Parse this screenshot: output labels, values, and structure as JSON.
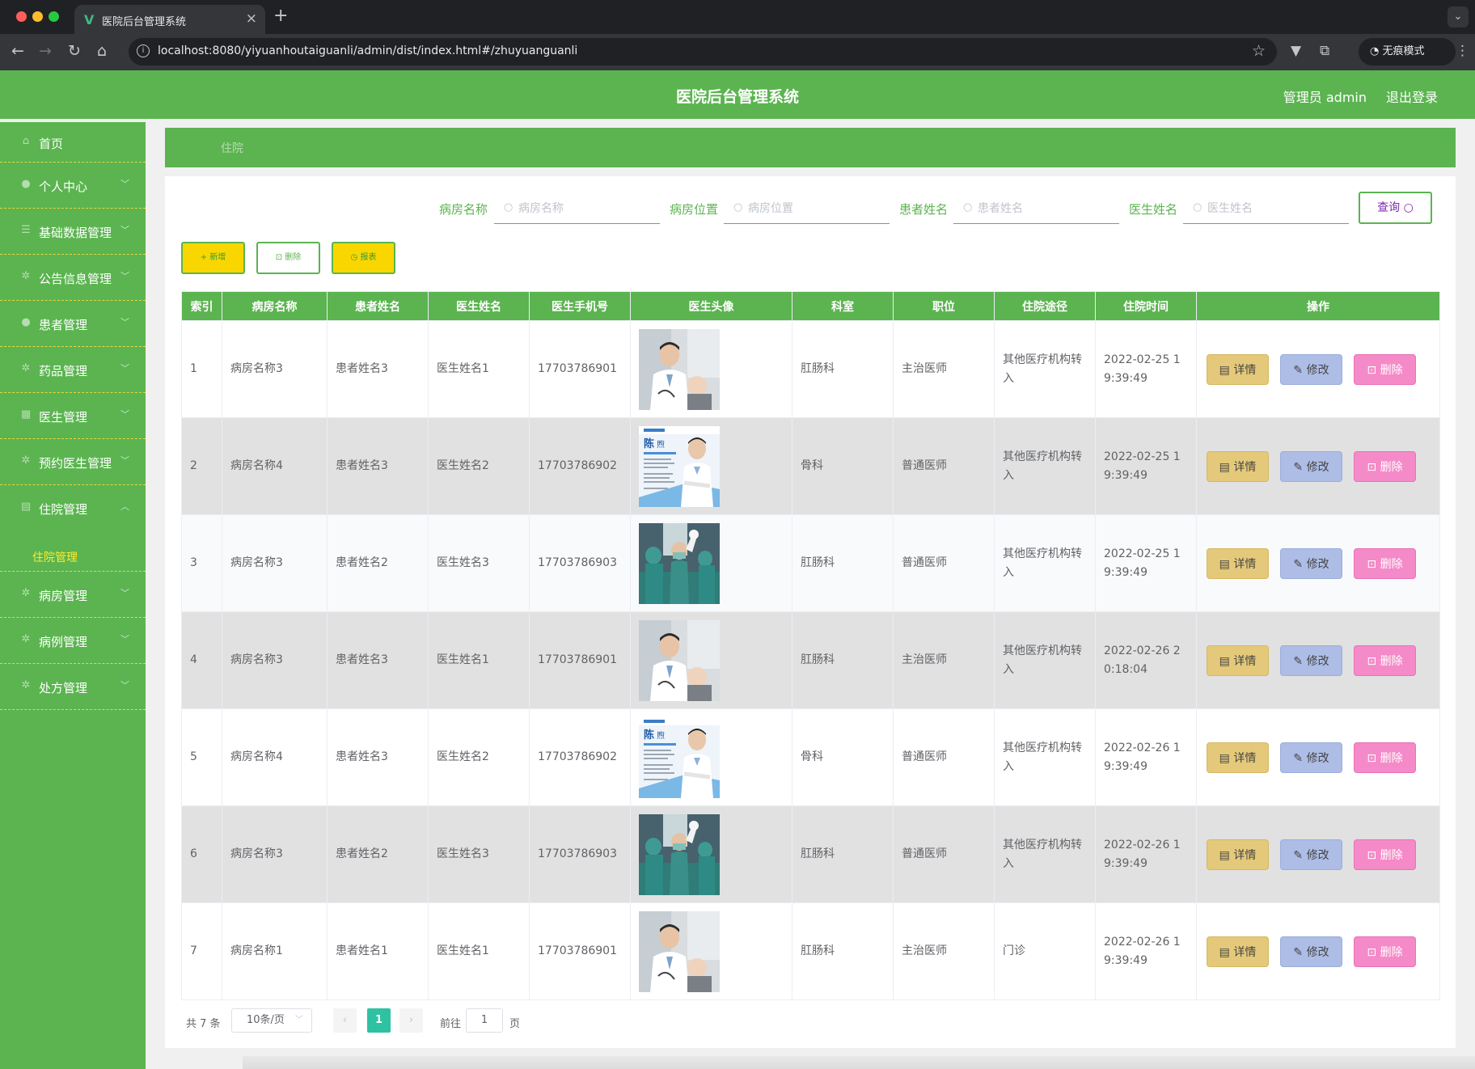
{
  "browser": {
    "tab_title": "医院后台管理系统",
    "url": "localhost:8080/yiyuanhoutaiguanli/admin/dist/index.html#/zhuyuanguanli",
    "incognito_label": "无痕模式"
  },
  "header": {
    "title": "医院后台管理系统",
    "user": "管理员 admin",
    "logout": "退出登录"
  },
  "sidebar": {
    "items": [
      {
        "label": "首页",
        "icon": "home-icon"
      },
      {
        "label": "个人中心",
        "icon": "user-icon"
      },
      {
        "label": "基础数据管理",
        "icon": "menu-icon"
      },
      {
        "label": "公告信息管理",
        "icon": "setting-icon"
      },
      {
        "label": "患者管理",
        "icon": "user-icon"
      },
      {
        "label": "药品管理",
        "icon": "setting-icon"
      },
      {
        "label": "医生管理",
        "icon": "grid-icon"
      },
      {
        "label": "预约医生管理",
        "icon": "setting-icon"
      },
      {
        "label": "住院管理",
        "icon": "document-icon"
      },
      {
        "label": "病房管理",
        "icon": "setting-icon"
      },
      {
        "label": "病例管理",
        "icon": "setting-icon"
      },
      {
        "label": "处方管理",
        "icon": "setting-icon"
      }
    ],
    "submenu_label": "住院管理"
  },
  "breadcrumb": "住院",
  "search": {
    "ward_name_label": "病房名称",
    "ward_name_placeholder": "病房名称",
    "ward_location_label": "病房位置",
    "ward_location_placeholder": "病房位置",
    "patient_name_label": "患者姓名",
    "patient_name_placeholder": "患者姓名",
    "doctor_name_label": "医生姓名",
    "doctor_name_placeholder": "医生姓名",
    "query_button": "查询"
  },
  "actions": {
    "add": "新增",
    "delete": "删除",
    "report": "报表"
  },
  "table": {
    "columns": [
      "索引",
      "病房名称",
      "患者姓名",
      "医生姓名",
      "医生手机号",
      "医生头像",
      "科室",
      "职位",
      "住院途径",
      "住院时间",
      "操作"
    ],
    "op_labels": {
      "detail": "详情",
      "edit": "修改",
      "delete": "删除"
    },
    "rows": [
      {
        "index": "1",
        "ward": "病房名称3",
        "patient": "患者姓名3",
        "doctor": "医生姓名1",
        "phone": "17703786901",
        "avatar": "doctor-exam",
        "dept": "肛肠科",
        "title": "主治医师",
        "route": "其他医疗机构转入",
        "time": "2022-02-25 19:39:49"
      },
      {
        "index": "2",
        "ward": "病房名称4",
        "patient": "患者姓名3",
        "doctor": "医生姓名2",
        "phone": "17703786902",
        "avatar": "doctor-poster",
        "dept": "骨科",
        "title": "普通医师",
        "route": "其他医疗机构转入",
        "time": "2022-02-25 19:39:49"
      },
      {
        "index": "3",
        "ward": "病房名称3",
        "patient": "患者姓名2",
        "doctor": "医生姓名3",
        "phone": "17703786903",
        "avatar": "surgery-team",
        "dept": "肛肠科",
        "title": "普通医师",
        "route": "其他医疗机构转入",
        "time": "2022-02-25 19:39:49"
      },
      {
        "index": "4",
        "ward": "病房名称3",
        "patient": "患者姓名3",
        "doctor": "医生姓名1",
        "phone": "17703786901",
        "avatar": "doctor-exam",
        "dept": "肛肠科",
        "title": "主治医师",
        "route": "其他医疗机构转入",
        "time": "2022-02-26 20:18:04"
      },
      {
        "index": "5",
        "ward": "病房名称4",
        "patient": "患者姓名3",
        "doctor": "医生姓名2",
        "phone": "17703786902",
        "avatar": "doctor-poster",
        "dept": "骨科",
        "title": "普通医师",
        "route": "其他医疗机构转入",
        "time": "2022-02-26 19:39:49"
      },
      {
        "index": "6",
        "ward": "病房名称3",
        "patient": "患者姓名2",
        "doctor": "医生姓名3",
        "phone": "17703786903",
        "avatar": "surgery-team",
        "dept": "肛肠科",
        "title": "普通医师",
        "route": "其他医疗机构转入",
        "time": "2022-02-26 19:39:49"
      },
      {
        "index": "7",
        "ward": "病房名称1",
        "patient": "患者姓名1",
        "doctor": "医生姓名1",
        "phone": "17703786901",
        "avatar": "doctor-exam",
        "dept": "肛肠科",
        "title": "主治医师",
        "route": "门诊",
        "time": "2022-02-26 19:39:49"
      }
    ]
  },
  "pagination": {
    "total": "共 7 条",
    "page_size": "10条/页",
    "current_page": "1",
    "goto_label": "前往",
    "goto_value": "1",
    "goto_unit": "页"
  },
  "colors": {
    "primary_green": "#5bb450",
    "accent_yellow": "#fad600",
    "submenu_yellow": "#ffea2b",
    "page_active": "#2ec1a2"
  }
}
